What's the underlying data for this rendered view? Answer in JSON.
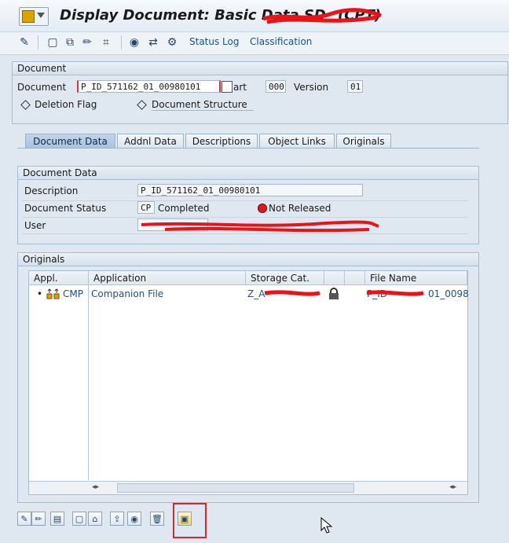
{
  "window": {
    "title": "Display Document: Basic Data SD",
    "title_suffix": "(CPT)"
  },
  "toolbar": {
    "status_log": "Status Log",
    "classification": "Classification"
  },
  "document_frame": {
    "heading": "Document",
    "document_label": "Document",
    "document_value": "P_ID_571162_01_00980101",
    "part_label": "art",
    "part_value": "000",
    "version_label": "Version",
    "version_value": "01",
    "deletion_flag": "Deletion Flag",
    "document_structure": "Document Structure"
  },
  "tabs": [
    {
      "label": "Document Data",
      "active": true
    },
    {
      "label": "Addnl Data"
    },
    {
      "label": "Descriptions"
    },
    {
      "label": "Object Links"
    },
    {
      "label": "Originals"
    }
  ],
  "document_data": {
    "heading": "Document Data",
    "description_label": "Description",
    "description_value": "P_ID_571162_01_00980101",
    "status_label": "Document Status",
    "status_code": "CP",
    "status_text": "Completed",
    "released_text": "Not Released",
    "user_label": "User"
  },
  "originals": {
    "heading": "Originals",
    "columns": [
      "Appl.",
      "Application",
      "Storage Cat.",
      "",
      "File Name"
    ],
    "rows": [
      {
        "bullet": "•",
        "appl": "CMP",
        "application": "Companion File",
        "storage": "Z_A",
        "file": "P_ID",
        "file_tail": "01_0098"
      }
    ]
  },
  "colors": {
    "background": "#dfe8f1",
    "link": "#1f4f8b",
    "highlight": "#d12b2b"
  }
}
